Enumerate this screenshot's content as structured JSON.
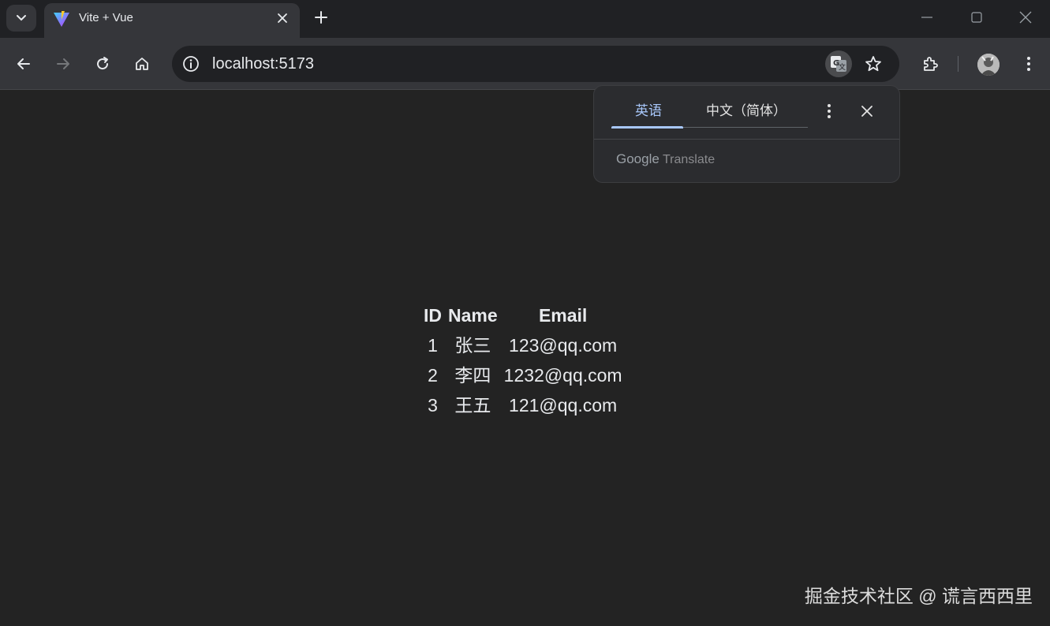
{
  "browser": {
    "tab": {
      "title": "Vite + Vue"
    },
    "address": {
      "url": "localhost:5173"
    }
  },
  "translate_popup": {
    "languages": [
      "英语",
      "中文（简体）"
    ],
    "active_language": "英语",
    "brand": {
      "google": "Google",
      "translate": "Translate"
    }
  },
  "table": {
    "headers": [
      "ID",
      "Name",
      "Email"
    ],
    "rows": [
      {
        "id": "1",
        "name": "张三",
        "email": "123@qq.com"
      },
      {
        "id": "2",
        "name": "李四",
        "email": "1232@qq.com"
      },
      {
        "id": "3",
        "name": "王五",
        "email": "121@qq.com"
      }
    ]
  },
  "watermark": "掘金技术社区 @ 谎言西西里",
  "colors": {
    "background": "#232323",
    "accent": "#a8c7fa",
    "text": "#e8eaed"
  },
  "icons": [
    "tab-search-icon",
    "vite-favicon",
    "close-icon",
    "plus-icon",
    "minimize-icon",
    "maximize-icon",
    "window-close-icon",
    "back-arrow-icon",
    "forward-arrow-icon",
    "reload-icon",
    "home-icon",
    "info-icon",
    "translate-icon",
    "star-icon",
    "extensions-icon",
    "kebab-menu-icon"
  ]
}
